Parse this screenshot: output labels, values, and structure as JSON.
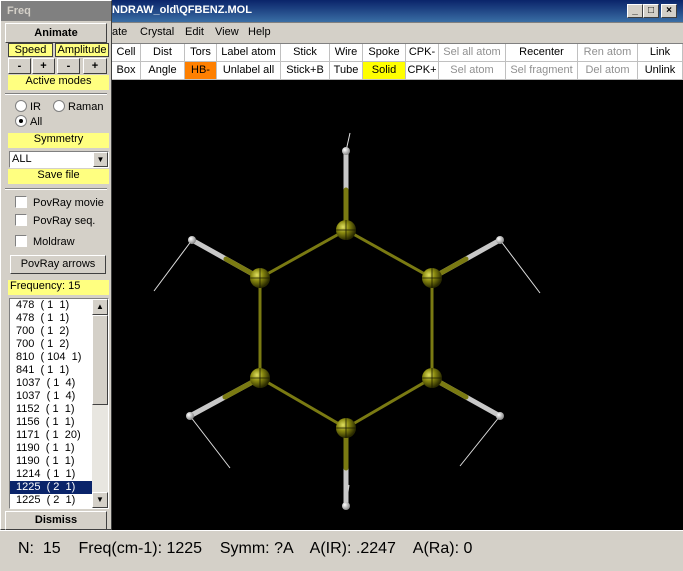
{
  "window": {
    "title": "NDRAW_old\\QFBENZ.MOL",
    "minimize_icon": "minimize-icon",
    "maximize_icon": "maximize-icon",
    "close_icon": "close-icon"
  },
  "menu": [
    "ate",
    "Crystal",
    "Edit",
    "View",
    "Help"
  ],
  "toolbar": {
    "row1": [
      "Cell",
      "Dist",
      "Tors",
      "Label atom",
      "Stick",
      "Wire",
      "Spoke",
      "CPK-",
      "Sel all atom",
      "Recenter",
      "Ren atom",
      "Link"
    ],
    "row2": [
      "Box",
      "Angle",
      "HB-",
      "Unlabel all",
      "Stick+B",
      "Tube",
      "Solid",
      "CPK+",
      "Sel atom",
      "Sel fragment",
      "Del atom",
      "Unlink"
    ]
  },
  "freq_panel": {
    "title": "Freq",
    "animate": "Animate",
    "speed": "Speed",
    "amplitude": "Amplitude",
    "minus": "-",
    "plus": "+",
    "active_modes": "Active modes",
    "ir": "IR",
    "raman": "Raman",
    "all": "All",
    "selected_mode": "All",
    "symmetry": "Symmetry",
    "symmetry_value": "ALL",
    "save_file": "Save file",
    "povray_movie": "PovRay movie",
    "povray_seq": "PovRay seq.",
    "moldraw": "Moldraw",
    "povray_arrows": "PovRay arrows",
    "frequency_label": "Frequency:  15",
    "dismiss": "Dismiss",
    "frequencies": [
      "478  ( 1  1)",
      "478  ( 1  1)",
      "700  ( 1  2)",
      "700  ( 1  2)",
      "810  ( 104  1)",
      "841  ( 1  1)",
      "1037  ( 1  4)",
      "1037  ( 1  4)",
      "1152  ( 1  1)",
      "1156  ( 1  1)",
      "1171  ( 1  20)",
      "1190  ( 1  1)",
      "1190  ( 1  1)",
      "1214  ( 1  1)",
      "1225  ( 2  1)",
      "1225  ( 2  1)"
    ],
    "selected_index": 14
  },
  "status": "N:  15    Freq(cm-1): 1225    Symm: ?A    A(IR): .2247    A(Ra): 0",
  "colors": {
    "carbon": "#8a8a10",
    "bond": "#7a7a12",
    "hydrogen_bond": "#c8c8c8",
    "vector": "#e0e0e0",
    "highlight_yellow": "#ffff80",
    "solid_yellow": "#ffff00",
    "hb_orange": "#ff8000"
  }
}
